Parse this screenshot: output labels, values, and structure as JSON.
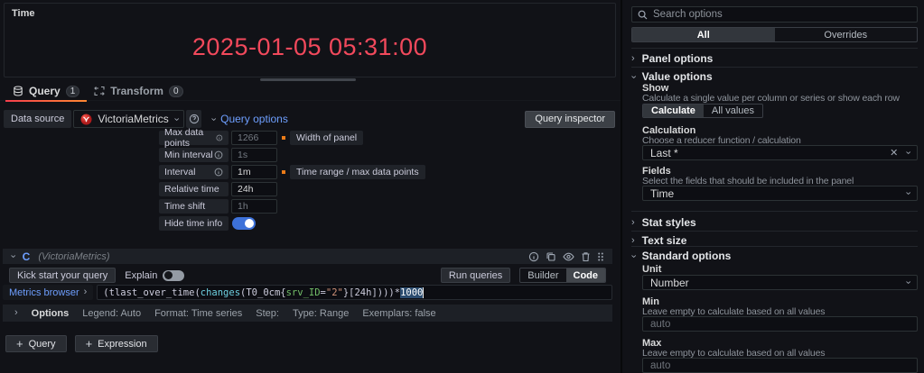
{
  "panel": {
    "title": "Time",
    "timestamp": "2025-01-05 05:31:00"
  },
  "tabs": {
    "query": "Query",
    "query_count": "1",
    "transform": "Transform",
    "transform_count": "0"
  },
  "datasource": {
    "label": "Data source",
    "name": "VictoriaMetrics"
  },
  "query_options": {
    "header": "Query options",
    "inspector": "Query inspector",
    "rows": [
      {
        "label": "Max data points",
        "value": "1266",
        "note": "Width of panel"
      },
      {
        "label": "Min interval",
        "value": "1s"
      },
      {
        "label": "Interval",
        "value": "1m",
        "note": "Time range / max data points"
      },
      {
        "label": "Relative time",
        "value": "24h"
      },
      {
        "label": "Time shift",
        "value": "1h"
      },
      {
        "label": "Hide time info"
      }
    ]
  },
  "query_row": {
    "ref_id": "C",
    "datasource_hint": "(VictoriaMetrics)",
    "kick_start": "Kick start your query",
    "explain": "Explain",
    "run_queries": "Run queries",
    "builder": "Builder",
    "code": "Code",
    "metrics_browser": "Metrics browser",
    "expression": {
      "seg1": "(tlast_over_time(",
      "seg2": "changes",
      "seg3": "(T0_0cm{",
      "seg4": "srv_ID",
      "seg5": "=",
      "seg6": "\"2\"",
      "seg7": "}[24h])))*",
      "seg8": "1000"
    },
    "options_label": "Options",
    "options_meta": [
      "Legend: Auto",
      "Format: Time series",
      "Step:",
      "Type: Range",
      "Exemplars: false"
    ]
  },
  "footer": {
    "add_query": "Query",
    "add_expression": "Expression"
  },
  "sidebar": {
    "search_placeholder": "Search options",
    "scope_all": "All",
    "scope_overrides": "Overrides",
    "panel_options": "Panel options",
    "value_options": "Value options",
    "show_label": "Show",
    "show_desc": "Calculate a single value per column or series or show each row",
    "show_calculate": "Calculate",
    "show_all_values": "All values",
    "calculation_label": "Calculation",
    "calculation_desc": "Choose a reducer function / calculation",
    "calculation_value": "Last *",
    "fields_label": "Fields",
    "fields_desc": "Select the fields that should be included in the panel",
    "fields_value": "Time",
    "stat_styles": "Stat styles",
    "text_size": "Text size",
    "standard_options": "Standard options",
    "unit_label": "Unit",
    "unit_value": "Number",
    "min_label": "Min",
    "min_desc": "Leave empty to calculate based on all values",
    "min_placeholder": "auto",
    "max_label": "Max",
    "max_desc": "Leave empty to calculate based on all values",
    "max_placeholder": "auto"
  },
  "colors": {
    "accent_red": "#f2495c",
    "accent_blue": "#6e9fff",
    "toggle_blue": "#3d71d9",
    "marker_orange": "#eb7b18"
  }
}
